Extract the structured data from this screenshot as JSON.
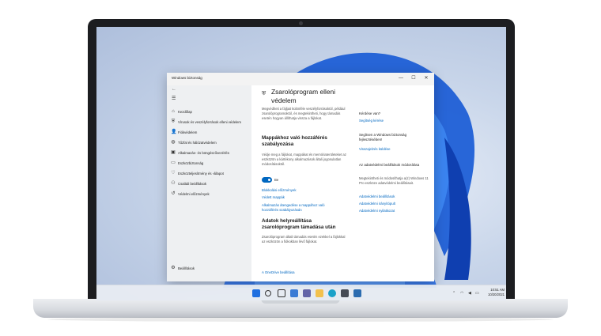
{
  "window": {
    "title": "Windows biztonság",
    "controls": {
      "minimize": "—",
      "maximize": "☐",
      "close": "✕"
    }
  },
  "sidebar": {
    "back": "←",
    "menu": "☰",
    "items": [
      {
        "label": "Kezdőlap",
        "icon": "⌂"
      },
      {
        "label": "Vírusok és veszélyforrások elleni védelem",
        "icon": "⛨"
      },
      {
        "label": "Fiókvédelem",
        "icon": "👤"
      },
      {
        "label": "Tűzfal és hálózatvédelem",
        "icon": "◍"
      },
      {
        "label": "Alkalmazás- és böngészővezérlés",
        "icon": "▣"
      },
      {
        "label": "Eszközbiztonság",
        "icon": "▭"
      },
      {
        "label": "Eszközteljesítmény és -állapot",
        "icon": "♡"
      },
      {
        "label": "Családi beállítások",
        "icon": "⚇"
      },
      {
        "label": "Védelmi előzmények",
        "icon": "↺"
      }
    ],
    "settings": {
      "label": "Beállítások",
      "icon": "⚙"
    }
  },
  "content": {
    "title": "Zsarolóprogram elleni védelem",
    "intro": "Megvédheti a fájljait különféle veszélyforrásoktól, például zsarolóprogramoktól, és megtekintheti, hogy támadás esetén hogyan állíthatja vissza a fájlokat.",
    "cfa_heading": "Mappákhoz való hozzáférés szabályozása",
    "cfa_text": "Védje meg a fájlokat, mappákat és memóriaterületeket az eszközön a kártékony alkalmazások általi jogosulatlan módosításoktól.",
    "toggle_label": "Be",
    "links": [
      "Blokkolási előzmények",
      "Védett mappák",
      "Alkalmazás átengedése a mappához való hozzáférés szabályozásán"
    ],
    "recovery_heading": "Adatok helyreállítása zsarolóprogram támadása után",
    "recovery_text": "Zsarolóprogram általi támadás esetén ezekkel a fájlokkal az eszközön a fiókokban lévő fájlokat.",
    "onedrive_link": "A OneDrive beállítása"
  },
  "right": {
    "q_heading": "Kérdése van?",
    "q_link": "Segítség kérése",
    "improve_heading": "Segítsen a Windows biztonság fejlesztésében!",
    "improve_link": "Visszajelzés küldése",
    "privacy_heading": "Az adatvédelmi beállítások módosítása",
    "privacy_text": "Megtekintheti és módosíthatja a(z) Windows 11 Pro eszköze adatvédelmi beállításait.",
    "privacy_links": [
      "Adatvédelmi beállítások",
      "Adatvédelmi irányítópult",
      "Adatvédelmi nyilatkozat"
    ]
  },
  "taskbar": {
    "apps": [
      "windows-start",
      "search",
      "task-view",
      "widgets",
      "chat",
      "file-explorer",
      "edge",
      "store",
      "security"
    ],
    "tray_up": "⌃",
    "tray_wifi": "◠",
    "tray_sound": "◀",
    "tray_battery": "▭",
    "time": "10:51 AM",
    "date": "10/20/2021"
  }
}
